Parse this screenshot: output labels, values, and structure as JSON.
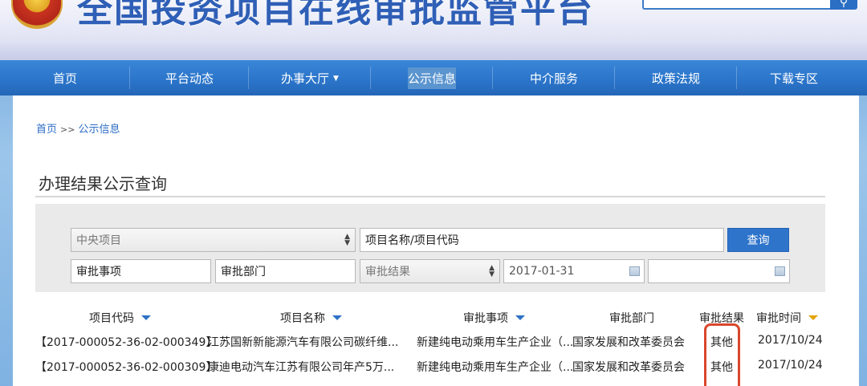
{
  "header": {
    "site_title": "全国投资项目在线审批监管平台",
    "search_icon": "search-icon"
  },
  "nav": {
    "items": [
      {
        "label": "首页"
      },
      {
        "label": "平台动态"
      },
      {
        "label": "办事大厅",
        "caret": "▼"
      },
      {
        "label": "公示信息"
      },
      {
        "label": "中介服务"
      },
      {
        "label": "政策法规"
      },
      {
        "label": "下载专区"
      }
    ],
    "active_index": 3
  },
  "breadcrumb": {
    "home": "首页",
    "separator": ">>",
    "current": "公示信息"
  },
  "section": {
    "title": "办理结果公示查询"
  },
  "filters": {
    "project_type": "中央项目",
    "project_name_placeholder": "项目名称/项目代码",
    "query_button": "查询",
    "approval_item": "审批事项",
    "approval_dept": "审批部门",
    "approval_result": "审批结果",
    "date_from": "2017-01-31",
    "date_to": ""
  },
  "table": {
    "columns": [
      "项目代码",
      "项目名称",
      "审批事项",
      "审批部门",
      "审批结果",
      "审批时间"
    ],
    "rows": [
      {
        "code": "【2017-000052-36-02-000349】",
        "name": "江苏国新新能源汽车有限公司碳纤维...",
        "item": "新建纯电动乘用车生产企业（...",
        "dept": "国家发展和改革委员会",
        "result": "其他",
        "time": "2017/10/24"
      },
      {
        "code": "【2017-000052-36-02-000309】",
        "name": "康迪电动汽车江苏有限公司年产5万...",
        "item": "新建纯电动乘用车生产企业（...",
        "dept": "国家发展和改革委员会",
        "result": "其他",
        "time": "2017/10/24"
      }
    ]
  },
  "colors": {
    "nav_bg": "#2a74c9",
    "link": "#2b6cc4",
    "query_button": "#2f74cb",
    "highlight": "#d9462c"
  }
}
